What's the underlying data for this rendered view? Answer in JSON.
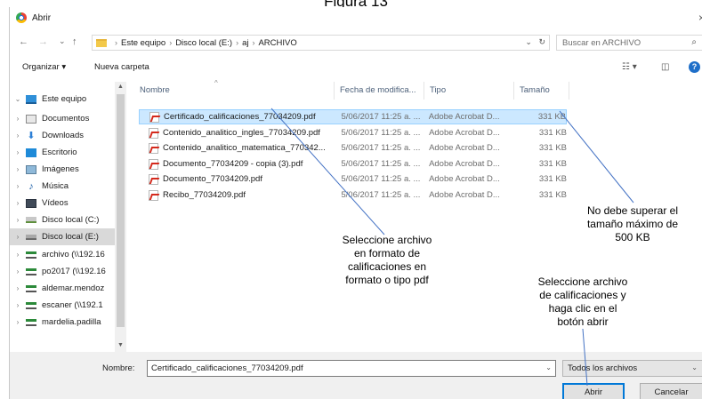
{
  "caption": "Figura 13",
  "window": {
    "title": "Abrir",
    "close_glyph": "×"
  },
  "nav": {
    "back": "←",
    "forward": "→",
    "recent": "⌄",
    "up": "↑",
    "breadcrumb": [
      "Este equipo",
      "Disco local (E:)",
      "aj",
      "ARCHIVO"
    ],
    "dropdown": "⌄",
    "refresh": "↻",
    "search_placeholder": "Buscar en ARCHIVO"
  },
  "toolbar": {
    "organize": "Organizar ▾",
    "new_folder": "Nueva carpeta",
    "view_glyph": "☷ ▾",
    "pane_glyph": "◫",
    "help_glyph": "?"
  },
  "sidebar": {
    "items": [
      {
        "label": "Este equipo",
        "icon": "pc-icon",
        "expanded": true
      },
      {
        "label": "Documentos",
        "icon": "documents-icon"
      },
      {
        "label": "Downloads",
        "icon": "download-icon"
      },
      {
        "label": "Escritorio",
        "icon": "desktop-icon"
      },
      {
        "label": "Imágenes",
        "icon": "pictures-icon"
      },
      {
        "label": "Música",
        "icon": "music-icon"
      },
      {
        "label": "Vídeos",
        "icon": "videos-icon"
      },
      {
        "label": "Disco local (C:)",
        "icon": "drive-icon"
      },
      {
        "label": "Disco local (E:)",
        "icon": "drive-icon",
        "selected": true
      },
      {
        "label": "archivo (\\\\192.16",
        "icon": "network-drive-icon"
      },
      {
        "label": "po2017 (\\\\192.16",
        "icon": "network-drive-icon"
      },
      {
        "label": "aldemar.mendoz",
        "icon": "network-drive-icon"
      },
      {
        "label": "escaner (\\\\192.1",
        "icon": "network-drive-icon"
      },
      {
        "label": "mardelia.padilla",
        "icon": "network-drive-icon"
      }
    ]
  },
  "columns": {
    "name": "Nombre",
    "date": "Fecha de modifica...",
    "type": "Tipo",
    "size": "Tamaño"
  },
  "files": [
    {
      "name": "Certificado_calificaciones_77034209.pdf",
      "date": "5/06/2017 11:25 a. ...",
      "type": "Adobe Acrobat D...",
      "size": "331 KB",
      "selected": true
    },
    {
      "name": "Contenido_analitico_ingles_77034209.pdf",
      "date": "5/06/2017 11:25 a. ...",
      "type": "Adobe Acrobat D...",
      "size": "331 KB"
    },
    {
      "name": "Contenido_analitico_matematica_770342...",
      "date": "5/06/2017 11:25 a. ...",
      "type": "Adobe Acrobat D...",
      "size": "331 KB"
    },
    {
      "name": "Documento_77034209 - copia (3).pdf",
      "date": "5/06/2017 11:25 a. ...",
      "type": "Adobe Acrobat D...",
      "size": "331 KB"
    },
    {
      "name": "Documento_77034209.pdf",
      "date": "5/06/2017 11:25 a. ...",
      "type": "Adobe Acrobat D...",
      "size": "331 KB"
    },
    {
      "name": "Recibo_77034209.pdf",
      "date": "5/06/2017 11:25 a. ...",
      "type": "Adobe Acrobat D...",
      "size": "331 KB"
    }
  ],
  "annotations": {
    "size_note": [
      "No debe superar el",
      "tamaño máximo de",
      "500 KB"
    ],
    "select_note": [
      "Seleccione archivo",
      "en formato de",
      "calificaciones en",
      "formato o tipo pdf"
    ],
    "open_note": [
      "Seleccione archivo",
      "de calificaciones y",
      "haga clic en el",
      "botón abrir"
    ]
  },
  "footer": {
    "filename_label": "Nombre:",
    "filename_value": "Certificado_calificaciones_77034209.pdf",
    "filter": "Todos los archivos",
    "open": "Abrir",
    "cancel": "Cancelar"
  }
}
